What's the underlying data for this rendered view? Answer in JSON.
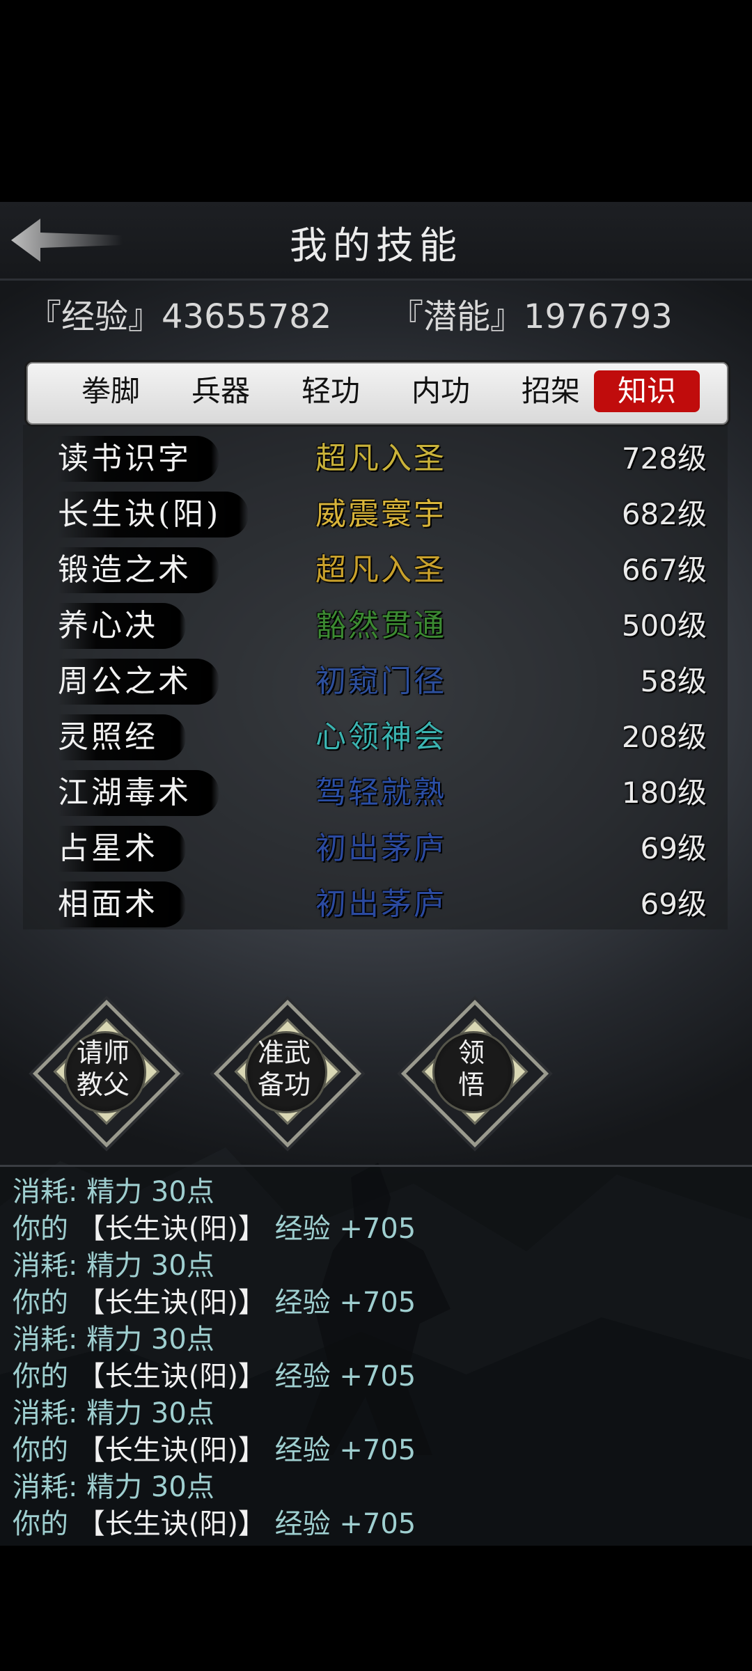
{
  "header": {
    "title": "我的技能"
  },
  "stats": {
    "exp": "『经验』43655782",
    "potential": "『潜能』1976793"
  },
  "tabs": [
    {
      "label": "拳脚",
      "active": false
    },
    {
      "label": "兵器",
      "active": false
    },
    {
      "label": "轻功",
      "active": false
    },
    {
      "label": "内功",
      "active": false
    },
    {
      "label": "招架",
      "active": false
    },
    {
      "label": "知识",
      "active": true
    }
  ],
  "skills": [
    {
      "name": "读书识字",
      "rank": "超凡入圣",
      "rank_color": "#c9b23a",
      "level": "728级"
    },
    {
      "name": "长生诀(阳)",
      "rank": "威震寰宇",
      "rank_color": "#d8b43a",
      "level": "682级"
    },
    {
      "name": "锻造之术",
      "rank": "超凡入圣",
      "rank_color": "#c9a12c",
      "level": "667级"
    },
    {
      "name": "养心决",
      "rank": "豁然贯通",
      "rank_color": "#3c8a32",
      "level": "500级"
    },
    {
      "name": "周公之术",
      "rank": "初窥门径",
      "rank_color": "#2d4f9c",
      "level": "58级"
    },
    {
      "name": "灵照经",
      "rank": "心领神会",
      "rank_color": "#3bb3b0",
      "level": "208级"
    },
    {
      "name": "江湖毒术",
      "rank": "驾轻就熟",
      "rank_color": "#2b4fa6",
      "level": "180级"
    },
    {
      "name": "占星术",
      "rank": "初出茅庐",
      "rank_color": "#2b4aa0",
      "level": "69级"
    },
    {
      "name": "相面术",
      "rank": "初出茅庐",
      "rank_color": "#2b4aa0",
      "level": "69级"
    }
  ],
  "actions": [
    {
      "line1": "请师",
      "line2": "教父"
    },
    {
      "line1": "准武",
      "line2": "备功"
    },
    {
      "line1": "领",
      "line2": "悟"
    }
  ],
  "log": [
    {
      "prefix": "消耗: ",
      "skill": "",
      "suffix": "精力 30点"
    },
    {
      "prefix": "你的 ",
      "skill": "【长生诀(阳)】",
      "suffix": " 经验 +705"
    },
    {
      "prefix": "消耗: ",
      "skill": "",
      "suffix": "精力 30点"
    },
    {
      "prefix": "你的 ",
      "skill": "【长生诀(阳)】",
      "suffix": " 经验 +705"
    },
    {
      "prefix": "消耗: ",
      "skill": "",
      "suffix": "精力 30点"
    },
    {
      "prefix": "你的 ",
      "skill": "【长生诀(阳)】",
      "suffix": " 经验 +705"
    },
    {
      "prefix": "消耗: ",
      "skill": "",
      "suffix": "精力 30点"
    },
    {
      "prefix": "你的 ",
      "skill": "【长生诀(阳)】",
      "suffix": " 经验 +705"
    },
    {
      "prefix": "消耗: ",
      "skill": "",
      "suffix": "精力 30点"
    },
    {
      "prefix": "你的 ",
      "skill": "【长生诀(阳)】",
      "suffix": " 经验 +705"
    }
  ],
  "icons": {
    "back": "back-arrow-icon"
  }
}
